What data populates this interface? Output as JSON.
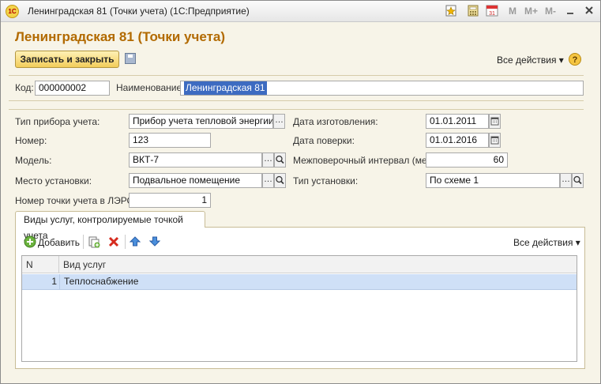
{
  "window": {
    "title": "Ленинградская 81 (Точки учета)  (1С:Предприятие)",
    "logo_text": "1С",
    "toolbar_m": [
      "M",
      "M+",
      "M-"
    ],
    "calendar_day": "31"
  },
  "form": {
    "heading": "Ленинградская 81 (Точки учета)",
    "save_close_label": "Записать и закрыть",
    "all_actions_label": "Все действия ▾",
    "help_label": "?"
  },
  "fields": {
    "code_label": "Код:",
    "code_value": "000000002",
    "name_label": "Наименование:",
    "name_value": "Ленинградская 81",
    "meter_type_label": "Тип прибора учета:",
    "meter_type_value": "Прибор учета тепловой энергии по",
    "number_label": "Номер:",
    "number_value": "123",
    "model_label": "Модель:",
    "model_value": "ВКТ-7",
    "location_label": "Место установки:",
    "location_value": "Подвальное помещение",
    "lers_label": "Номер точки учета в ЛЭРС:",
    "lers_value": "1",
    "manufacture_date_label": "Дата изготовления:",
    "manufacture_date_value": "01.01.2011",
    "verification_date_label": "Дата поверки:",
    "verification_date_value": "01.01.2016",
    "interval_label": "Межповерочный интервал (мес):",
    "interval_value": "60",
    "install_type_label": "Тип установки:",
    "install_type_value": "По схеме 1"
  },
  "tab": {
    "label": "Виды услуг, контролируемые точкой учета"
  },
  "table_toolbar": {
    "add_label": "Добавить",
    "all_actions_label": "Все действия ▾"
  },
  "table": {
    "columns": [
      "N",
      "Вид услуг"
    ],
    "rows": [
      {
        "n": "1",
        "service": "Теплоснабжение"
      }
    ]
  },
  "colors": {
    "heading": "#b26a00",
    "primary_button": "#f2cd5a",
    "selected_row": "#cfe0f7"
  },
  "icons": [
    "save-icon",
    "help-icon",
    "calendar-icon",
    "select-icon",
    "search-icon",
    "add-icon",
    "copy-icon",
    "delete-icon",
    "arrow-up-icon",
    "arrow-down-icon"
  ]
}
